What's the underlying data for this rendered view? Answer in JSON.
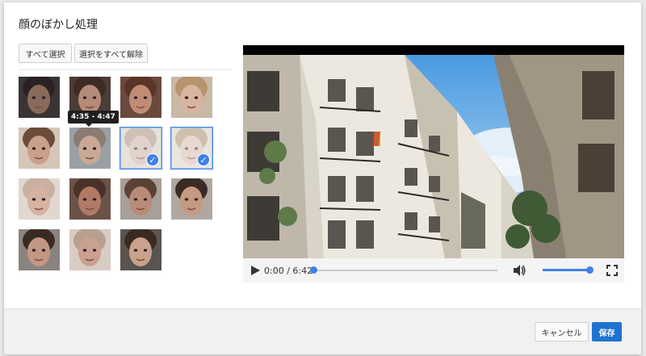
{
  "dialog": {
    "title": "顔のぼかし処理"
  },
  "toolbar": {
    "select_all": "すべて選択",
    "deselect_all": "選択をすべて解除"
  },
  "faces": [
    {
      "selected": false,
      "skin": "#8a6a5a",
      "hair": "#2a2222",
      "bg": "#3a3434"
    },
    {
      "selected": false,
      "skin": "#b58a78",
      "hair": "#3b2b22",
      "bg": "#4c3c36"
    },
    {
      "selected": false,
      "skin": "#c08c76",
      "hair": "#5a3426",
      "bg": "#6a4a3e"
    },
    {
      "selected": false,
      "skin": "#d9b4a0",
      "hair": "#b7946f",
      "bg": "#c8b8a8"
    },
    {
      "selected": false,
      "skin": "#caa08a",
      "hair": "#6b4c3a",
      "bg": "#d6c6b8"
    },
    {
      "selected": false,
      "skin": "#c9a896",
      "hair": "#8a7c72",
      "bg": "#9aa0a6"
    },
    {
      "selected": true,
      "skin": "#c8aea0",
      "hair": "#a88c78",
      "bg": "#d2c8c0"
    },
    {
      "selected": true,
      "skin": "#d8b8a8",
      "hair": "#a88a6a",
      "bg": "#d8d0c8"
    },
    {
      "selected": false,
      "skin": "#d6b2a0",
      "hair": "#c9b0a0",
      "bg": "#e0d8d0"
    },
    {
      "selected": false,
      "skin": "#b07a66",
      "hair": "#4a3228",
      "bg": "#6b5248"
    },
    {
      "selected": false,
      "skin": "#b88c78",
      "hair": "#5a4236",
      "bg": "#a8a098"
    },
    {
      "selected": false,
      "skin": "#c49a82",
      "hair": "#3a2c24",
      "bg": "#b0a8a0"
    },
    {
      "selected": false,
      "skin": "#c29884",
      "hair": "#3a2a22",
      "bg": "#8a8480"
    },
    {
      "selected": false,
      "skin": "#caa090",
      "hair": "#b8a090",
      "bg": "#d8ccc4"
    },
    {
      "selected": false,
      "skin": "#caa28c",
      "hair": "#3a2a20",
      "bg": "#5a5450"
    }
  ],
  "tooltip": {
    "text": "4:35 - 4:47"
  },
  "player": {
    "time": "0:00 / 6:42",
    "progress": 0.0,
    "volume": 1.0
  },
  "footer": {
    "cancel": "キャンセル",
    "save": "保存"
  },
  "colors": {
    "accent": "#3d82e8",
    "save_button": "#1e73d1"
  },
  "icons": {
    "play": "play-icon",
    "volume": "volume-icon",
    "fullscreen": "fullscreen-icon",
    "check": "check-icon"
  }
}
